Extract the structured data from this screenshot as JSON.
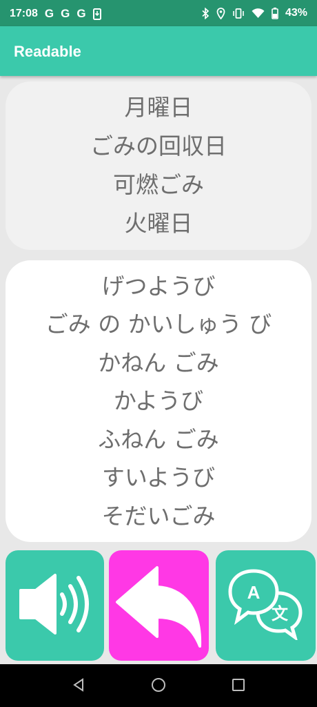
{
  "status_bar": {
    "time": "17:08",
    "notification_icons": [
      "G",
      "G",
      "G"
    ],
    "battery": "43%"
  },
  "app_bar": {
    "title": "Readable"
  },
  "kanji_card": {
    "lines": [
      "月曜日",
      "ごみの回収日",
      "可燃ごみ",
      "火曜日"
    ]
  },
  "kana_card": {
    "lines": [
      "げつようび",
      "ごみ の かいしゅう び",
      "かねん ごみ",
      "かようび",
      "ふねん ごみ",
      "すいようび",
      "そだいごみ"
    ]
  },
  "buttons": {
    "speak": {
      "icon": "speaker-icon",
      "color": "#3bc9ab"
    },
    "back": {
      "icon": "back-arrow-icon",
      "color": "#ff38e5"
    },
    "translate": {
      "icon": "translate-icon",
      "color": "#3bc9ab"
    }
  },
  "colors": {
    "app_bar": "#3bc9ab",
    "status_bar": "#26946f",
    "text": "#6e6e6e"
  }
}
